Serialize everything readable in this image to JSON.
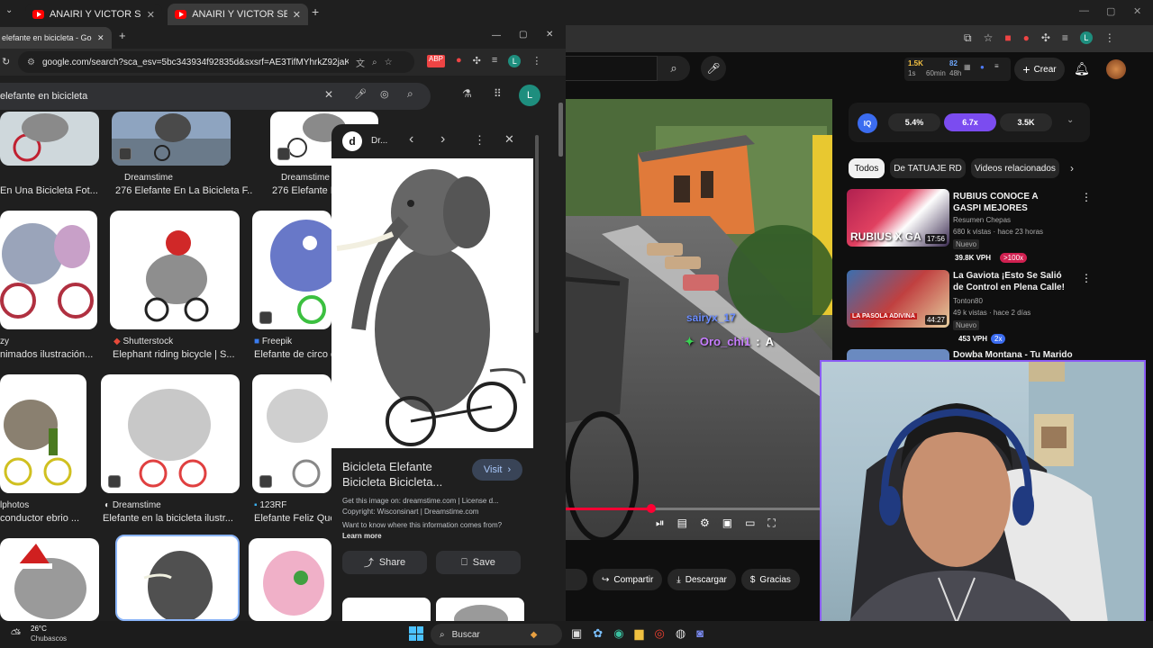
{
  "outer_tabs": [
    {
      "label": "ANAIRI Y VICTOR SE METE UN I"
    },
    {
      "label": "ANAIRI Y VICTOR SE METE UN I"
    }
  ],
  "google_window": {
    "tab_label": "elefante en bicicleta - Google S",
    "url": "google.com/search?sca_esv=5bc343934f92835d&sxsrf=AE3TifMYhrkZ92jaKwX3n...",
    "search_query": "elefante en bicicleta",
    "avatar_letter": "L",
    "results": [
      {
        "source": "",
        "title": "En Una Bicicleta Fot..."
      },
      {
        "source": "Dreamstime",
        "title": "276 Elefante En La Bicicleta F..."
      },
      {
        "source": "Dreamstime",
        "title": "276 Elefante E"
      },
      {
        "source": "zy",
        "title": "nimados ilustración..."
      },
      {
        "source": "Shutterstock",
        "title": "Elephant riding bicycle | S..."
      },
      {
        "source": "Freepik",
        "title": "Elefante de circo e"
      },
      {
        "source": "lphotos",
        "title": "conductor ebrio ..."
      },
      {
        "source": "Dreamstime",
        "title": "Elefante en la bicicleta ilustr..."
      },
      {
        "source": "123RF",
        "title": "Elefante Feliz Que"
      }
    ],
    "preview": {
      "source_short": "Dr...",
      "title": "Bicicleta Elefante Bicicleta Bicicleta...",
      "visit_label": "Visit",
      "info_line1": "Get this image on: dreamstime.com | License d...",
      "info_line2": "Copyright: Wisconsinart | Dreamstime.com",
      "info_line3": "Want to know where this information comes from?",
      "learn_more": "Learn more",
      "share_label": "Share",
      "save_label": "Save"
    }
  },
  "youtube": {
    "create_label": "Crear",
    "stats": {
      "views": "1.5K",
      "views_sub": "1s",
      "time": "60min",
      "subs": "82",
      "subs_sub": "48h"
    },
    "metrics": [
      {
        "label": "IQ"
      },
      {
        "value": "5.4%"
      },
      {
        "value": "6.7x"
      },
      {
        "value": "3.5K"
      }
    ],
    "chips": [
      "Todos",
      "De TATUAJE RD",
      "Videos relacionados"
    ],
    "chat": [
      {
        "user": "sairyx_17",
        "msg": ""
      },
      {
        "user": "Oro_chi1",
        "msg": "A"
      }
    ],
    "actions": [
      "Compartir",
      "Descargar",
      "Gracias"
    ],
    "related": [
      {
        "title": "RUBIUS CONOCE A GASPI MEJORES MOMENTOS",
        "channel": "Resumen Chepas",
        "meta": "680 k vistas · hace 23 horas",
        "badge": "Nuevo",
        "vph": "39.8K VPH",
        "mult": ">100x",
        "duration": "17:56",
        "thumb_text": "RUBIUS X GA"
      },
      {
        "title": "La Gaviota ¡Esto Se Salió de Control en Plena Calle!",
        "channel": "Tonton80",
        "meta": "49 k vistas · hace 2 días",
        "badge": "Nuevo",
        "vph": "453 VPH",
        "mult": "2x",
        "duration": "44:27",
        "thumb_text": "LA PASOLA ADIVINA"
      },
      {
        "title": "Dowba Montana - Tu Marido ft"
      }
    ]
  },
  "taskbar": {
    "temp": "26°C",
    "weather": "Chubascos",
    "search": "Buscar"
  }
}
